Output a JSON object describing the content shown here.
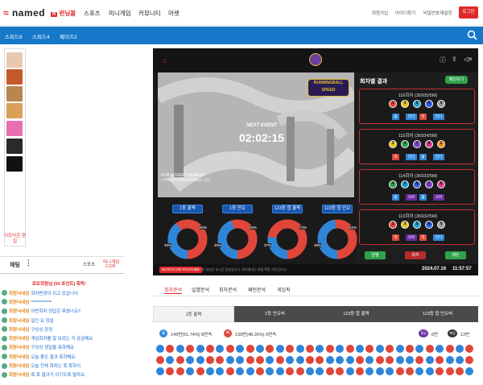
{
  "topbar": {
    "logo": "named",
    "nav": [
      {
        "label": "런닝볼",
        "hot": true
      },
      {
        "label": "스포츠",
        "hot": false
      },
      {
        "label": "미니게임",
        "hot": false
      },
      {
        "label": "커뮤니티",
        "hot": false
      },
      {
        "label": "마켓",
        "hot": false
      }
    ],
    "links": [
      "회원가입",
      "아이디찾기",
      "비밀번호재설정"
    ],
    "login": "로그인"
  },
  "subnav": {
    "tabs": [
      "스피드6",
      "스피드4",
      "페이즈2"
    ]
  },
  "sidebar": {
    "edit_label": "이모티콘 편집",
    "thumbs": [
      "#e8c9b0",
      "#c45a2a",
      "#b8864f",
      "#d9a05a",
      "#e86fb0",
      "#2a2a2a",
      "#111"
    ]
  },
  "chat": {
    "title": "채팅",
    "tab1": "스포츠",
    "tab2": "미니게임",
    "count": "2,226",
    "banner": "로또회원님 [50 포인트] 획득!",
    "messages": [
      {
        "name": "회원닉네임",
        "text": "회차변경이 되고 있습니다."
      },
      {
        "name": "회원닉네임",
        "text": "========"
      },
      {
        "name": "회원닉네임",
        "text": "이번회차 정답은 뭐였나요?"
      },
      {
        "name": "회원닉네임",
        "text": "일인 요 정말"
      },
      {
        "name": "회원닉네임",
        "text": "구싱싱 강정"
      },
      {
        "name": "회원닉네임",
        "text": "게임회차를 잘 보셨는 지 궁금해요"
      },
      {
        "name": "회원닉네임",
        "text": "구싱싱 생일을 축하해요"
      },
      {
        "name": "회원닉네임",
        "text": "오늘 좋은 결과 축하해요."
      },
      {
        "name": "회원닉네임",
        "text": "오늘 전체 회차는 흑 흑하이"
      },
      {
        "name": "회원닉네임",
        "text": "흑 흑 결과가 이기도록 될까요"
      }
    ]
  },
  "video": {
    "logo_text": "RUNNINGBALL SPEED",
    "next_event_label": "NEXT EVENT",
    "timer": "02:02:15",
    "advert": "FOR ADVERTISEMENT\n> PR@RUNNINGBALL.CO",
    "footer_left": "WATCH ON YOUTUBE",
    "footer_note": "* 본 영상은 실시간 방송입니다. 회차결과는 최종 확정 기준입니다.",
    "date": "2024.07.16",
    "time": "11:57:57"
  },
  "stats": {
    "title": "회차별 결과",
    "btn": "패턴보기",
    "cards": [
      {
        "title": "116회차 (36935/5M)",
        "balls": [
          "1",
          "3",
          "5",
          "6",
          "9"
        ],
        "tags": [
          "홀",
          "언더",
          "짝",
          "언더"
        ]
      },
      {
        "title": "115회차 (36934/5M)",
        "balls": [
          "3",
          "4",
          "7",
          "8",
          "2"
        ],
        "tags": [
          "짝",
          "언더",
          "홀",
          "언더"
        ]
      },
      {
        "title": "114회차 (36933/5M)",
        "balls": [
          "4",
          "5",
          "6",
          "7",
          "8"
        ],
        "tags": [
          "홀",
          "오버",
          "홀",
          "오버"
        ]
      },
      {
        "title": "113회차 (36932/5M)",
        "balls": [
          "1",
          "3",
          "5",
          "6",
          "9"
        ],
        "tags": [
          "짝",
          "오버",
          "짝",
          "언더"
        ]
      }
    ],
    "bottom_tabs": [
      "일별",
      "회차",
      "패턴"
    ],
    "donuts": [
      {
        "label": "1등 홀짝",
        "left": "40%",
        "right": "60%"
      },
      {
        "label": "1등 언오",
        "left": "45%",
        "right": "55%"
      },
      {
        "label": "123등 합 홀짝",
        "left": "27%",
        "right": "73%"
      },
      {
        "label": "123등 합 언오",
        "left": "48%",
        "right": "52%"
      }
    ]
  },
  "lowtabs": [
    "회차분석",
    "일별분석",
    "회차분석",
    "패턴분석",
    "게임픽"
  ],
  "grid": {
    "tabs": [
      "1등 홀짝",
      "1등 언오버",
      "123등 합 홀짝",
      "123등 합 언오버"
    ],
    "odd_label": "149번(51.74%) 8연속",
    "even_label": "139번(48.26%) 9연속",
    "odd_icon": "홀",
    "even_icon": "짝",
    "right1": "6번",
    "right2": "13번",
    "right1_icon": "흥입",
    "right2_icon": "패입"
  }
}
